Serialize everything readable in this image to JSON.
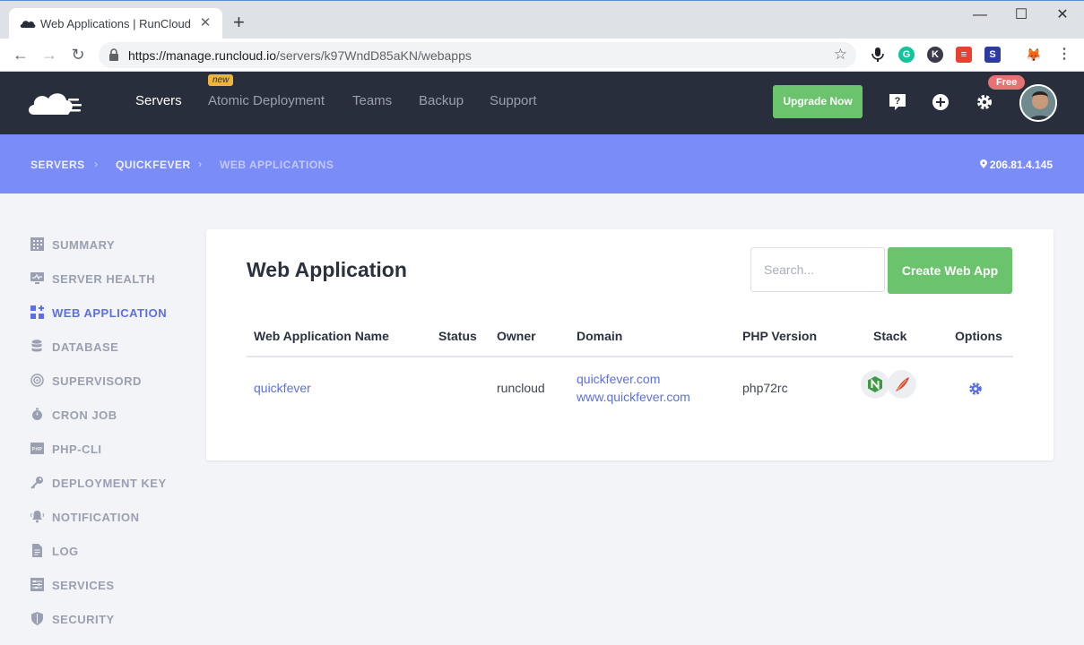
{
  "browser": {
    "tab_title": "Web Applications | RunCloud",
    "url_host": "https://manage.runcloud.io",
    "url_path": "/servers/k97WndD85aKN/webapps",
    "controls": {
      "minimize": "—",
      "maximize": "☐",
      "close": "✕"
    }
  },
  "header": {
    "nav": [
      {
        "label": "Servers",
        "active": true
      },
      {
        "label": "Atomic Deployment",
        "active": false
      },
      {
        "label": "Teams",
        "active": false
      },
      {
        "label": "Backup",
        "active": false
      },
      {
        "label": "Support",
        "active": false
      }
    ],
    "new_badge": "new",
    "upgrade_label": "Upgrade Now",
    "free_badge": "Free"
  },
  "breadcrumb": {
    "items": [
      "SERVERS",
      "QUICKFEVER",
      "WEB APPLICATIONS"
    ],
    "ip": "206.81.4.145"
  },
  "sidebar": {
    "items": [
      {
        "label": "SUMMARY",
        "icon": "grid-icon"
      },
      {
        "label": "SERVER HEALTH",
        "icon": "monitor-icon"
      },
      {
        "label": "WEB APPLICATION",
        "icon": "apps-icon",
        "active": true
      },
      {
        "label": "DATABASE",
        "icon": "database-icon"
      },
      {
        "label": "SUPERVISORD",
        "icon": "target-icon"
      },
      {
        "label": "CRON JOB",
        "icon": "stopwatch-icon"
      },
      {
        "label": "PHP-CLI",
        "icon": "php-icon"
      },
      {
        "label": "DEPLOYMENT KEY",
        "icon": "key-icon"
      },
      {
        "label": "NOTIFICATION",
        "icon": "bell-icon"
      },
      {
        "label": "LOG",
        "icon": "file-icon"
      },
      {
        "label": "SERVICES",
        "icon": "services-icon"
      },
      {
        "label": "SECURITY",
        "icon": "shield-icon"
      }
    ]
  },
  "main": {
    "title": "Web Application",
    "search_placeholder": "Search...",
    "create_label": "Create Web App",
    "table": {
      "headers": [
        "Web Application Name",
        "Status",
        "Owner",
        "Domain",
        "PHP Version",
        "Stack",
        "Options"
      ],
      "rows": [
        {
          "name": "quickfever",
          "status": "",
          "owner": "runcloud",
          "domains": [
            "quickfever.com",
            "www.quickfever.com"
          ],
          "php": "php72rc",
          "stack": [
            "nginx-icon",
            "apache-feather-icon"
          ]
        }
      ]
    }
  },
  "colors": {
    "header_bg": "#292e3d",
    "crumb_bg": "#7a8cf7",
    "accent": "#5b6fe6",
    "green": "#6bc46d",
    "free_badge": "#e57373"
  }
}
